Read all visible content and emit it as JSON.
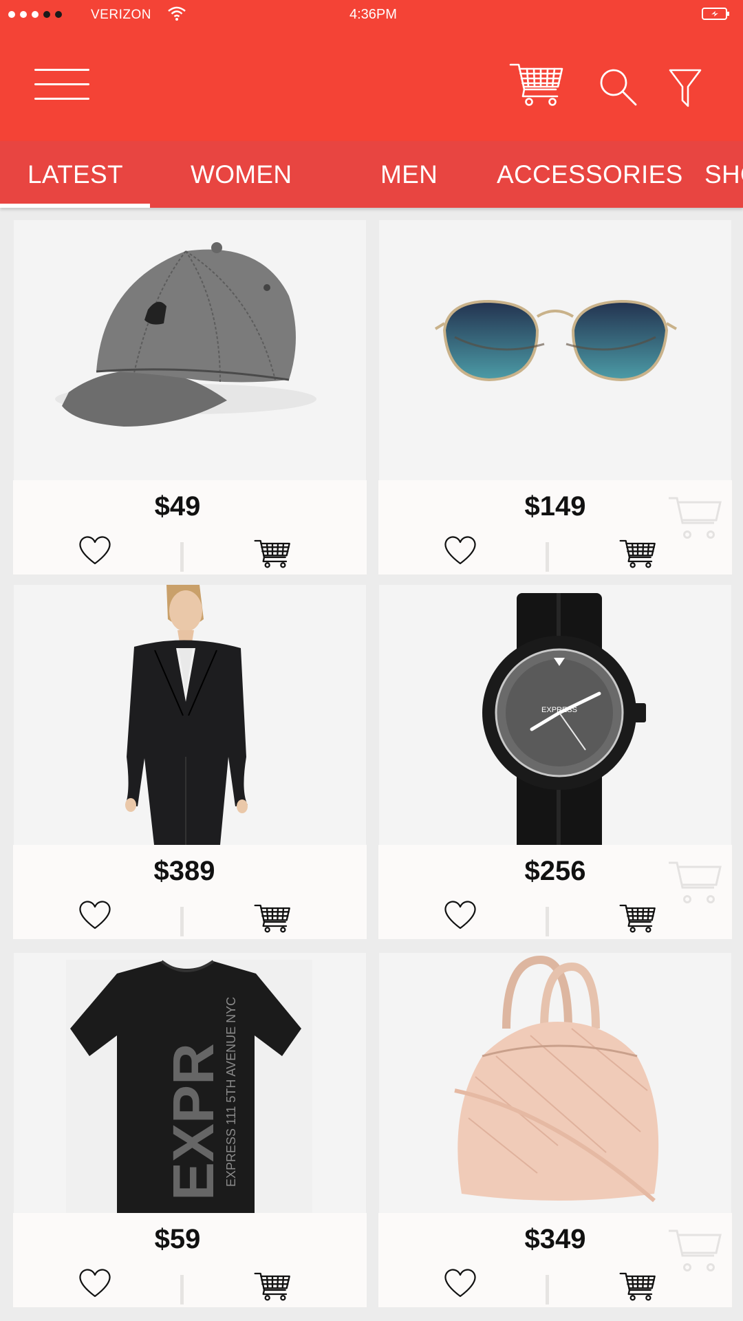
{
  "status_bar": {
    "carrier": "VERIZON",
    "time": "4:36PM",
    "icons": [
      "signal-dots",
      "wifi-icon",
      "battery-icon"
    ]
  },
  "header": {
    "icons": [
      "menu-icon",
      "cart-icon",
      "search-icon",
      "filter-icon"
    ]
  },
  "tabs": [
    {
      "label": "LATEST",
      "active": true
    },
    {
      "label": "WOMEN",
      "active": false
    },
    {
      "label": "MEN",
      "active": false
    },
    {
      "label": "ACCESSORIES",
      "active": false
    },
    {
      "label": "SHO",
      "active": false
    }
  ],
  "products": [
    {
      "name": "cap",
      "price": "$49"
    },
    {
      "name": "sunglasses",
      "price": "$149"
    },
    {
      "name": "blazer-suit",
      "price": "$389"
    },
    {
      "name": "watch",
      "price": "$256",
      "watch_brand": "EXPRESS"
    },
    {
      "name": "t-shirt",
      "price": "$59",
      "shirt_print": "EXPR",
      "shirt_subtext": "EXPRESS 111 5TH AVENUE NYC"
    },
    {
      "name": "handbag",
      "price": "$349"
    }
  ],
  "colors": {
    "header": "#f44336",
    "tabs": "#e84541",
    "background": "#ececec"
  }
}
